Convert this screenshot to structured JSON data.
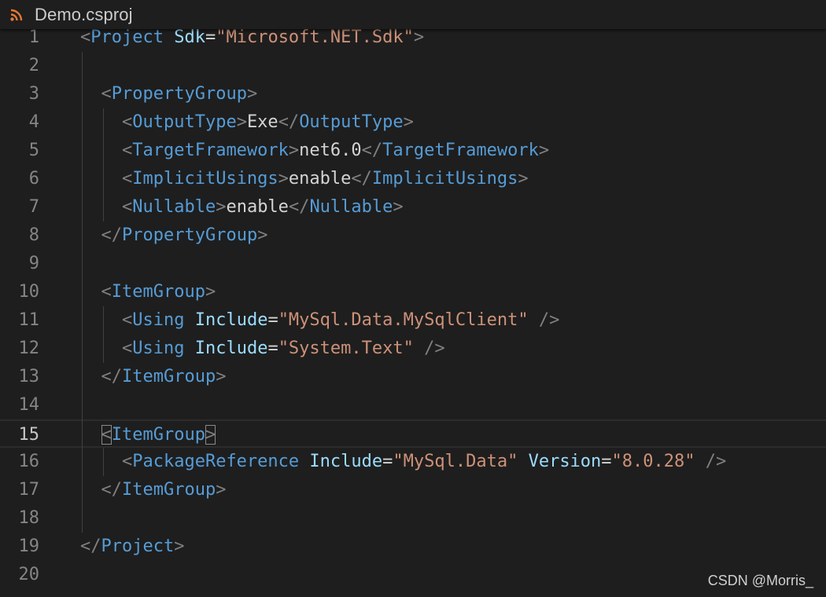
{
  "tab": {
    "icon": "rss-icon",
    "title": "Demo.csproj"
  },
  "editor": {
    "active_line": 15,
    "lines": [
      {
        "n": "1",
        "tokens": [
          [
            "punct",
            "<"
          ],
          [
            "tag",
            "Project"
          ],
          [
            "text",
            " "
          ],
          [
            "attr",
            "Sdk"
          ],
          [
            "eq",
            "="
          ],
          [
            "str",
            "\"Microsoft.NET.Sdk\""
          ],
          [
            "punct",
            ">"
          ]
        ]
      },
      {
        "n": "2",
        "tokens": []
      },
      {
        "n": "3",
        "tokens": [
          [
            "text",
            "  "
          ],
          [
            "punct",
            "<"
          ],
          [
            "tag",
            "PropertyGroup"
          ],
          [
            "punct",
            ">"
          ]
        ]
      },
      {
        "n": "4",
        "tokens": [
          [
            "text",
            "    "
          ],
          [
            "punct",
            "<"
          ],
          [
            "tag",
            "OutputType"
          ],
          [
            "punct",
            ">"
          ],
          [
            "text",
            "Exe"
          ],
          [
            "punct",
            "</"
          ],
          [
            "tag",
            "OutputType"
          ],
          [
            "punct",
            ">"
          ]
        ]
      },
      {
        "n": "5",
        "tokens": [
          [
            "text",
            "    "
          ],
          [
            "punct",
            "<"
          ],
          [
            "tag",
            "TargetFramework"
          ],
          [
            "punct",
            ">"
          ],
          [
            "text",
            "net6.0"
          ],
          [
            "punct",
            "</"
          ],
          [
            "tag",
            "TargetFramework"
          ],
          [
            "punct",
            ">"
          ]
        ]
      },
      {
        "n": "6",
        "tokens": [
          [
            "text",
            "    "
          ],
          [
            "punct",
            "<"
          ],
          [
            "tag",
            "ImplicitUsings"
          ],
          [
            "punct",
            ">"
          ],
          [
            "text",
            "enable"
          ],
          [
            "punct",
            "</"
          ],
          [
            "tag",
            "ImplicitUsings"
          ],
          [
            "punct",
            ">"
          ]
        ]
      },
      {
        "n": "7",
        "tokens": [
          [
            "text",
            "    "
          ],
          [
            "punct",
            "<"
          ],
          [
            "tag",
            "Nullable"
          ],
          [
            "punct",
            ">"
          ],
          [
            "text",
            "enable"
          ],
          [
            "punct",
            "</"
          ],
          [
            "tag",
            "Nullable"
          ],
          [
            "punct",
            ">"
          ]
        ]
      },
      {
        "n": "8",
        "tokens": [
          [
            "text",
            "  "
          ],
          [
            "punct",
            "</"
          ],
          [
            "tag",
            "PropertyGroup"
          ],
          [
            "punct",
            ">"
          ]
        ]
      },
      {
        "n": "9",
        "tokens": []
      },
      {
        "n": "10",
        "tokens": [
          [
            "text",
            "  "
          ],
          [
            "punct",
            "<"
          ],
          [
            "tag",
            "ItemGroup"
          ],
          [
            "punct",
            ">"
          ]
        ]
      },
      {
        "n": "11",
        "tokens": [
          [
            "text",
            "    "
          ],
          [
            "punct",
            "<"
          ],
          [
            "tag",
            "Using"
          ],
          [
            "text",
            " "
          ],
          [
            "attr",
            "Include"
          ],
          [
            "eq",
            "="
          ],
          [
            "str",
            "\"MySql.Data.MySqlClient\""
          ],
          [
            "text",
            " "
          ],
          [
            "punct",
            "/>"
          ]
        ]
      },
      {
        "n": "12",
        "tokens": [
          [
            "text",
            "    "
          ],
          [
            "punct",
            "<"
          ],
          [
            "tag",
            "Using"
          ],
          [
            "text",
            " "
          ],
          [
            "attr",
            "Include"
          ],
          [
            "eq",
            "="
          ],
          [
            "str",
            "\"System.Text\""
          ],
          [
            "text",
            " "
          ],
          [
            "punct",
            "/>"
          ]
        ]
      },
      {
        "n": "13",
        "tokens": [
          [
            "text",
            "  "
          ],
          [
            "punct",
            "</"
          ],
          [
            "tag",
            "ItemGroup"
          ],
          [
            "punct",
            ">"
          ]
        ]
      },
      {
        "n": "14",
        "tokens": []
      },
      {
        "n": "15",
        "tokens": [
          [
            "text",
            "  "
          ],
          [
            "punct",
            "<"
          ],
          [
            "tag",
            "ItemGroup"
          ],
          [
            "punct",
            ">"
          ]
        ]
      },
      {
        "n": "16",
        "tokens": [
          [
            "text",
            "    "
          ],
          [
            "punct",
            "<"
          ],
          [
            "tag",
            "PackageReference"
          ],
          [
            "text",
            " "
          ],
          [
            "attr",
            "Include"
          ],
          [
            "eq",
            "="
          ],
          [
            "str",
            "\"MySql.Data\""
          ],
          [
            "text",
            " "
          ],
          [
            "attr",
            "Version"
          ],
          [
            "eq",
            "="
          ],
          [
            "str",
            "\"8.0.28\""
          ],
          [
            "text",
            " "
          ],
          [
            "punct",
            "/>"
          ]
        ]
      },
      {
        "n": "17",
        "tokens": [
          [
            "text",
            "  "
          ],
          [
            "punct",
            "</"
          ],
          [
            "tag",
            "ItemGroup"
          ],
          [
            "punct",
            ">"
          ]
        ]
      },
      {
        "n": "18",
        "tokens": []
      },
      {
        "n": "19",
        "tokens": [
          [
            "punct",
            "</"
          ],
          [
            "tag",
            "Project"
          ],
          [
            "punct",
            ">"
          ]
        ]
      },
      {
        "n": "20",
        "tokens": []
      }
    ]
  },
  "watermark": "CSDN @Morris_",
  "colors": {
    "background": "#1e1e1e",
    "tag": "#569cd6",
    "attribute": "#9cdcfe",
    "string": "#ce9178",
    "punctuation": "#808080",
    "text": "#d4d4d4",
    "line_number": "#858585"
  }
}
